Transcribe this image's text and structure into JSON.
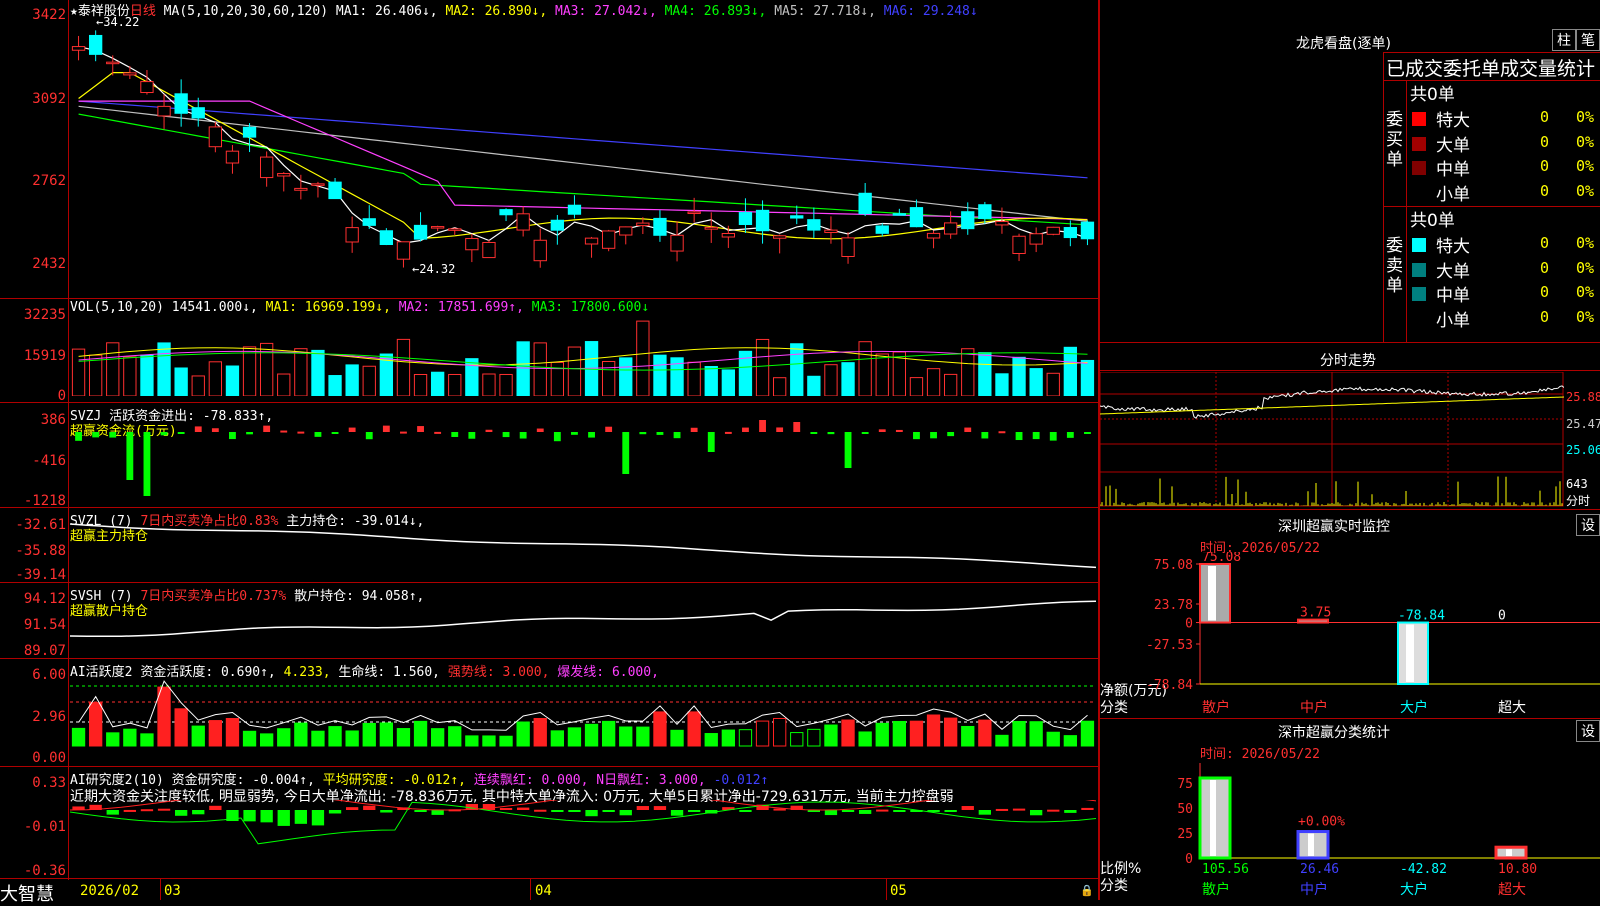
{
  "main": {
    "stock_name": "★泰祥股份",
    "period": "日线",
    "ma_params": "MA(5,10,20,30,60,120)",
    "ma": [
      {
        "label": "MA1: 26.406↓,",
        "color": "#ffffff"
      },
      {
        "label": "MA2: 26.890↓,",
        "color": "#ffff00"
      },
      {
        "label": "MA3: 27.042↓,",
        "color": "#ff40ff"
      },
      {
        "label": "MA4: 26.893↓,",
        "color": "#00ff00"
      },
      {
        "label": "MA5: 27.718↓,",
        "color": "#c0c0c0"
      },
      {
        "label": "MA6: 29.248↓",
        "color": "#4040ff"
      }
    ],
    "y_ticks": [
      "3422",
      "3092",
      "2762",
      "2432"
    ],
    "high_label": "34.22",
    "low_label": "24.32"
  },
  "vol": {
    "title": "VOL(5,10,20)",
    "value": "14541.000↓,",
    "ma1": "MA1: 16969.199↓,",
    "ma2": "MA2: 17851.699↑,",
    "ma3": "MA3: 17800.600↓",
    "y_ticks": [
      "32235",
      "15919",
      "0"
    ]
  },
  "svzj": {
    "title": "SVZJ  活跃资金进出: -78.833↑,",
    "subtitle": "超赢资金流(万元)",
    "y_ticks": [
      "386",
      "-416",
      "-1218"
    ]
  },
  "svzl": {
    "title": "SVZL (7)",
    "ratio": "7日内买卖净占比0.83%",
    "holding": "主力持仓: -39.014↓,",
    "subtitle": "超赢主力持仓",
    "y_ticks": [
      "-32.61",
      "-35.88",
      "-39.14"
    ]
  },
  "svsh": {
    "title": "SVSH (7)",
    "ratio": "7日内买卖净占比0.737%",
    "holding": "散户持仓: 94.058↑,",
    "subtitle": "超赢散户持仓",
    "y_ticks": [
      "94.12",
      "91.54",
      "89.07"
    ]
  },
  "ai1": {
    "title": "AI活跃度2",
    "active": "资金活跃度: 0.690↑,",
    "v2": "4.233,",
    "life": "生命线: 1.560,",
    "strong": "强势线: 3.000,",
    "burst": "爆发线: 6.000,",
    "y_ticks": [
      "6.00",
      "2.96",
      "0.00"
    ]
  },
  "ai2": {
    "title": "AI研究度2(10)",
    "research": "资金研究度: -0.004↑,",
    "avg": "平均研究度: -0.012↑,",
    "cont": "连续飘红: 0.000,",
    "nday": "N日飘红: 3.000,",
    "last": "-0.012↑",
    "comment": "近期大资金关注度较低, 明显弱势, 今日大单净流出: -78.836万元, 其中特大单净流入: 0万元, 大单5日累计净出-729.631万元, 当前主力控盘弱",
    "y_ticks": [
      "0.33",
      "-0.01",
      "-0.36"
    ]
  },
  "bottom": {
    "brand": "大智慧",
    "dates": [
      "2026/02",
      "03",
      "04",
      "05"
    ]
  },
  "right": {
    "lhkp_title": "龙虎看盘(逐单)",
    "btn_zhu": "柱",
    "btn_bi": "笔",
    "stats_title": "已成交委托单成交量统计",
    "buy_label": "委买单",
    "sell_label": "委卖单",
    "buy_total": "共0单",
    "sell_total": "共0单",
    "rows": [
      {
        "name": "特大",
        "n": "0",
        "pct": "0%"
      },
      {
        "name": "大单",
        "n": "0",
        "pct": "0%"
      },
      {
        "name": "中单",
        "n": "0",
        "pct": "0%"
      },
      {
        "name": "小单",
        "n": "0",
        "pct": "0%"
      }
    ],
    "fenshi_title": "分时走势",
    "fenshi_prices": [
      "25.88",
      "25.47",
      "25.06"
    ],
    "fenshi_vol": "643",
    "fenshi_vol_label": "分时",
    "monitor_title": "深圳超赢实时监控",
    "monitor_btn": "设",
    "monitor_time": "时间: 2026/05/22",
    "monitor_ticks": [
      "75.08",
      "23.78",
      "0",
      "-27.53",
      "-78.84"
    ],
    "monitor_ylabel": "净额(万元)",
    "monitor_xlabel": "分类",
    "monitor_values": [
      {
        "cat": "散户",
        "value": "75.08"
      },
      {
        "cat": "中户",
        "value": "3.75"
      },
      {
        "cat": "大户",
        "value": "-78.84"
      },
      {
        "cat": "超大",
        "value": "0"
      }
    ],
    "class_title": "深市超赢分类统计",
    "class_btn": "设",
    "class_time": "时间: 2026/05/22",
    "class_ticks": [
      "75",
      "50",
      "25",
      "0"
    ],
    "class_ylabel": "比例%",
    "class_xlabel": "分类",
    "class_bar_label": "+0.00%",
    "class_values": [
      {
        "cat": "散户",
        "value": "105.56"
      },
      {
        "cat": "中户",
        "value": "26.46"
      },
      {
        "cat": "大户",
        "value": "-42.82"
      },
      {
        "cat": "超大",
        "value": "10.80"
      }
    ]
  }
}
